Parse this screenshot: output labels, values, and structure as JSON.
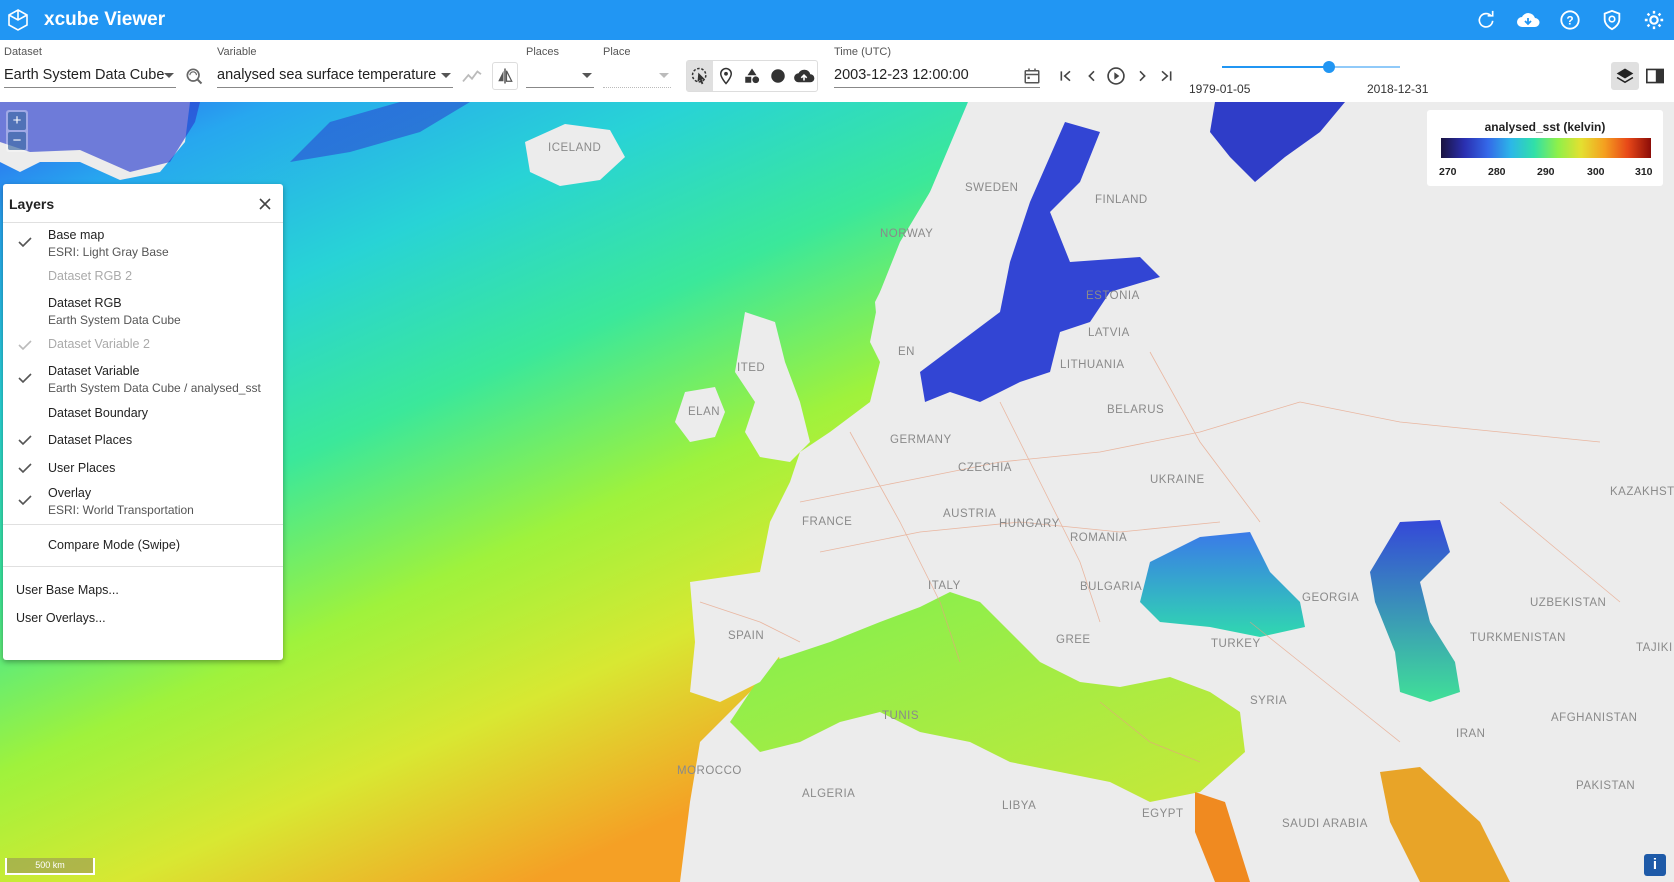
{
  "app": {
    "title": "xcube Viewer"
  },
  "header_icons": [
    "refresh-icon",
    "cloud-download-icon",
    "help-icon",
    "policy-icon",
    "settings-icon"
  ],
  "toolbar": {
    "dataset": {
      "label": "Dataset",
      "value": "Earth System Data Cube"
    },
    "variable": {
      "label": "Variable",
      "value": "analysed sea surface temperature"
    },
    "places": {
      "label": "Places",
      "value": ""
    },
    "place": {
      "label": "Place",
      "value": ""
    },
    "time": {
      "label": "Time (UTC)",
      "value": "2003-12-23 12:00:00"
    },
    "time_slider": {
      "min_label": "1979-01-05",
      "max_label": "2018-12-31",
      "position_fraction": 0.6
    }
  },
  "legend": {
    "title": "analysed_sst (kelvin)",
    "ticks": [
      "270",
      "280",
      "290",
      "300",
      "310"
    ]
  },
  "layers_panel": {
    "title": "Layers",
    "items": [
      {
        "primary": "Base map",
        "secondary": "ESRI: Light Gray Base",
        "checked": true,
        "disabled": false
      },
      {
        "primary": "Dataset RGB 2",
        "secondary": "",
        "checked": false,
        "disabled": true
      },
      {
        "primary": "Dataset RGB",
        "secondary": "Earth System Data Cube",
        "checked": false,
        "disabled": false
      },
      {
        "primary": "Dataset Variable 2",
        "secondary": "",
        "checked": true,
        "disabled": true
      },
      {
        "primary": "Dataset Variable",
        "secondary": "Earth System Data Cube / analysed_sst",
        "checked": true,
        "disabled": false
      },
      {
        "primary": "Dataset Boundary",
        "secondary": "",
        "checked": false,
        "disabled": false
      },
      {
        "primary": "Dataset Places",
        "secondary": "",
        "checked": true,
        "disabled": false
      },
      {
        "primary": "User Places",
        "secondary": "",
        "checked": true,
        "disabled": false
      },
      {
        "primary": "Overlay",
        "secondary": "ESRI: World Transportation",
        "checked": true,
        "disabled": false
      }
    ],
    "compare_mode": "Compare Mode (Swipe)",
    "user_base_maps": "User Base Maps...",
    "user_overlays": "User Overlays..."
  },
  "map_labels": [
    "ICELAND",
    "SWEDEN",
    "FINLAND",
    "NORWAY",
    "ESTONIA",
    "LATVIA",
    "LITHUANIA",
    "BELARUS",
    "GERMANY",
    "CZECHIA",
    "UKRAINE",
    "KAZAKHSTA",
    "FRANCE",
    "AUSTRIA",
    "HUNGARY",
    "ROMANIA",
    "ITALY",
    "BULGARIA",
    "GEORGIA",
    "UZBEKISTAN",
    "TURKMENISTAN",
    "TAJIKI",
    "SPAIN",
    "TURKEY",
    "SYRIA",
    "AFGHANISTAN",
    "IRAN",
    "TUNIS",
    "MOROCCO",
    "ALGERIA",
    "LIBYA",
    "EGYPT",
    "PAKISTAN",
    "SAUDI ARABIA",
    "ITED",
    "ELAN",
    "EN",
    "GREE"
  ],
  "scale_bar": "500 km",
  "attribution_button": "i"
}
